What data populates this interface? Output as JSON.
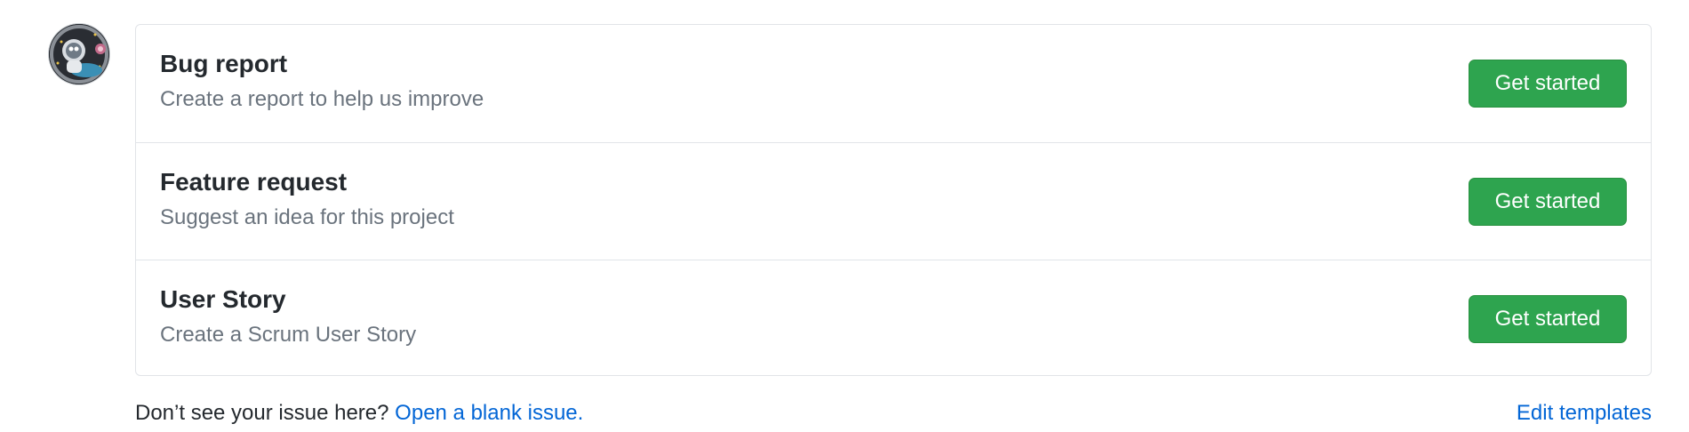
{
  "avatar": {
    "icon": "astronaut-avatar-icon"
  },
  "templates": [
    {
      "title": "Bug report",
      "description": "Create a report to help us improve",
      "button_label": "Get started"
    },
    {
      "title": "Feature request",
      "description": "Suggest an idea for this project",
      "button_label": "Get started"
    },
    {
      "title": "User Story",
      "description": "Create a Scrum User Story",
      "button_label": "Get started"
    }
  ],
  "footer": {
    "prompt": "Don’t see your issue here?",
    "blank_issue_link": "Open a blank issue.",
    "edit_templates_link": "Edit templates"
  },
  "colors": {
    "button_green": "#2ea44f",
    "link_blue": "#0366d6",
    "muted_text": "#6a737d",
    "border": "#e1e4e8"
  }
}
